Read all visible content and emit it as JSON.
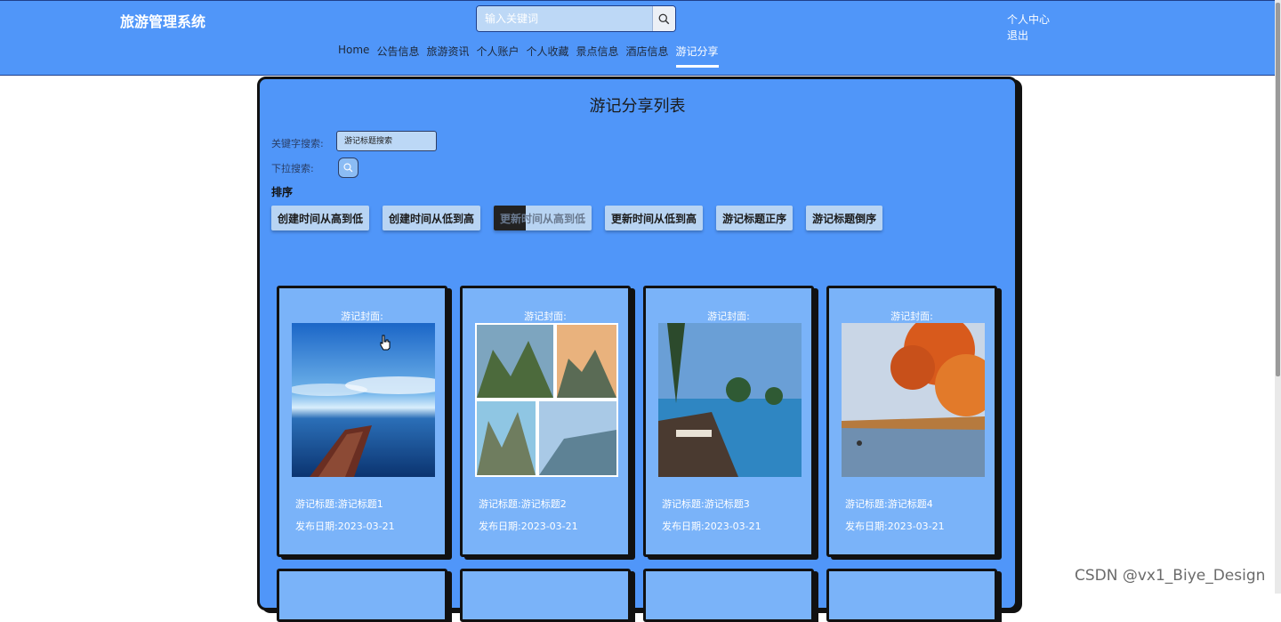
{
  "header": {
    "brand": "旅游管理系统",
    "search_placeholder": "输入关键词",
    "user_center": "个人中心",
    "logout": "退出",
    "nav": [
      "Home",
      "公告信息",
      "旅游资讯",
      "个人账户",
      "个人收藏",
      "景点信息",
      "酒店信息",
      "游记分享"
    ],
    "active_nav": "游记分享"
  },
  "main": {
    "title": "游记分享列表",
    "keyword_label": "关键字搜索:",
    "keyword_placeholder": "游记标题搜索",
    "dropdown_label": "下拉搜索:",
    "sort_title": "排序",
    "sort_buttons": [
      "创建时间从高到低",
      "创建时间从低到高",
      "更新时间从高到低",
      "更新时间从低到高",
      "游记标题正序",
      "游记标题倒序"
    ]
  },
  "cards": [
    {
      "cover_label": "游记封面:",
      "title": "游记标题:游记标题1",
      "date": "发布日期:2023-03-21"
    },
    {
      "cover_label": "游记封面:",
      "title": "游记标题:游记标题2",
      "date": "发布日期:2023-03-21"
    },
    {
      "cover_label": "游记封面:",
      "title": "游记标题:游记标题3",
      "date": "发布日期:2023-03-21"
    },
    {
      "cover_label": "游记封面:",
      "title": "游记标题:游记标题4",
      "date": "发布日期:2023-03-21"
    }
  ],
  "watermark": "CSDN @vx1_Biye_Design",
  "colors": {
    "accent": "#5096f9",
    "card": "#7ab3f9",
    "border": "#111111"
  }
}
